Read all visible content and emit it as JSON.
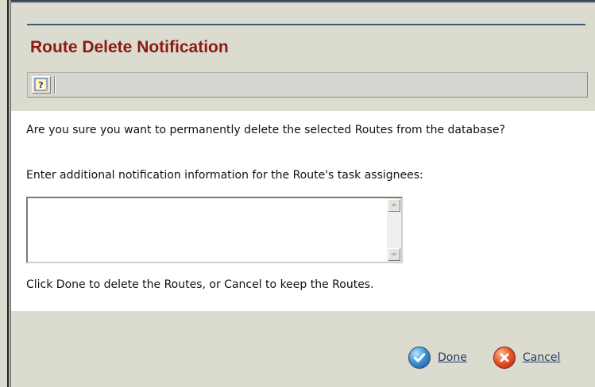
{
  "dialog": {
    "title": "Route Delete Notification"
  },
  "toolbar": {
    "help_icon": "help-question-icon",
    "help_glyph": "?"
  },
  "content": {
    "message": "Are you sure you want to permanently delete the selected Routes from the database?",
    "input_label": "Enter additional notification information for the Route's task assignees:",
    "notification_value": "",
    "instructions": "Click Done to delete the Routes, or Cancel to keep the Routes."
  },
  "actions": {
    "done_label": "Done",
    "done_icon": "checkmark-icon",
    "cancel_label": "Cancel",
    "cancel_icon": "close-icon"
  },
  "colors": {
    "title": "#8b1a10",
    "link": "#233b6b",
    "done_icon": "#3f95d6",
    "cancel_icon": "#e85a2b"
  }
}
